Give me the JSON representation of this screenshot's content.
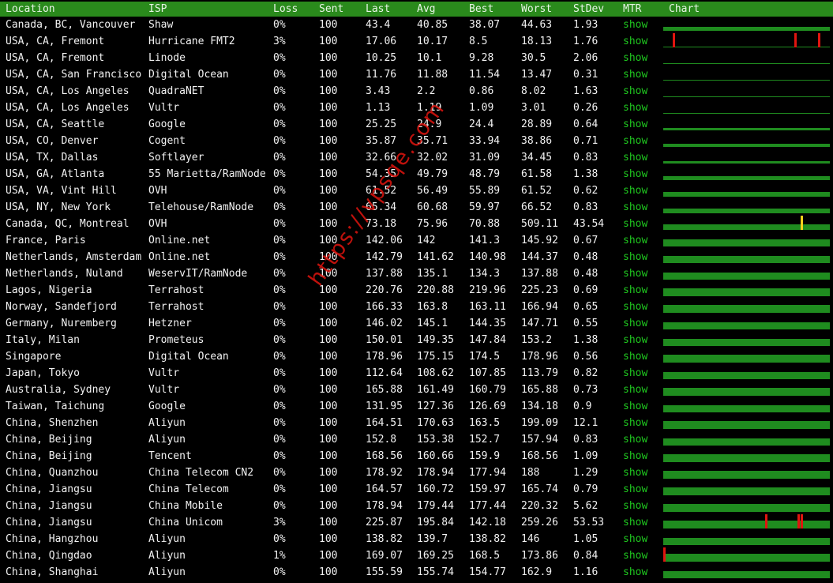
{
  "columns": [
    "Location",
    "ISP",
    "Loss",
    "Sent",
    "Last",
    "Avg",
    "Best",
    "Worst",
    "StDev",
    "MTR",
    "Chart"
  ],
  "colors": {
    "header_bg": "#2a8a1c",
    "link": "#1fc71f",
    "spark_green": "#1f8c1f",
    "loss_red": "#e0150f",
    "latency_yellow": "#f2d21c"
  },
  "watermark": "https://vpsqe.com",
  "rows": [
    {
      "location": "Canada, BC, Vancouver",
      "isp": "Shaw",
      "loss": "0%",
      "sent": "100",
      "last": "43.4",
      "avg": "40.85",
      "best": "38.07",
      "worst": "44.63",
      "stdev": "1.93",
      "mtr": "show",
      "spark_level": 0.5,
      "spikes": []
    },
    {
      "location": "USA, CA, Fremont",
      "isp": "Hurricane FMT2",
      "loss": "3%",
      "sent": "100",
      "last": "17.06",
      "avg": "10.17",
      "best": "8.5",
      "worst": "18.13",
      "stdev": "1.76",
      "mtr": "show",
      "spark_level": 0.1,
      "spikes": [
        {
          "pos": 0.06,
          "color": "red"
        },
        {
          "pos": 0.81,
          "color": "red"
        },
        {
          "pos": 0.96,
          "color": "red"
        }
      ]
    },
    {
      "location": "USA, CA, Fremont",
      "isp": "Linode",
      "loss": "0%",
      "sent": "100",
      "last": "10.25",
      "avg": "10.1",
      "best": "9.28",
      "worst": "30.5",
      "stdev": "2.06",
      "mtr": "show",
      "spark_level": 0.05,
      "spikes": []
    },
    {
      "location": "USA, CA, San Francisco",
      "isp": "Digital Ocean",
      "loss": "0%",
      "sent": "100",
      "last": "11.76",
      "avg": "11.88",
      "best": "11.54",
      "worst": "13.47",
      "stdev": "0.31",
      "mtr": "show",
      "spark_level": 0.05,
      "spikes": []
    },
    {
      "location": "USA, CA, Los Angeles",
      "isp": "QuadraNET",
      "loss": "0%",
      "sent": "100",
      "last": "3.43",
      "avg": "2.2",
      "best": "0.86",
      "worst": "8.02",
      "stdev": "1.63",
      "mtr": "show",
      "spark_level": 0.05,
      "spikes": []
    },
    {
      "location": "USA, CA, Los Angeles",
      "isp": "Vultr",
      "loss": "0%",
      "sent": "100",
      "last": "1.13",
      "avg": "1.19",
      "best": "1.09",
      "worst": "3.01",
      "stdev": "0.26",
      "mtr": "show",
      "spark_level": 0.05,
      "spikes": []
    },
    {
      "location": "USA, CA, Seattle",
      "isp": "Google",
      "loss": "0%",
      "sent": "100",
      "last": "25.25",
      "avg": "24.9",
      "best": "24.4",
      "worst": "28.89",
      "stdev": "0.64",
      "mtr": "show",
      "spark_level": 0.25,
      "spikes": []
    },
    {
      "location": "USA, CO, Denver",
      "isp": "Cogent",
      "loss": "0%",
      "sent": "100",
      "last": "35.87",
      "avg": "35.71",
      "best": "33.94",
      "worst": "38.86",
      "stdev": "0.71",
      "mtr": "show",
      "spark_level": 0.35,
      "spikes": []
    },
    {
      "location": "USA, TX, Dallas",
      "isp": "Softlayer",
      "loss": "0%",
      "sent": "100",
      "last": "32.66",
      "avg": "32.02",
      "best": "31.09",
      "worst": "34.45",
      "stdev": "0.83",
      "mtr": "show",
      "spark_level": 0.3,
      "spikes": []
    },
    {
      "location": "USA, GA, Atlanta",
      "isp": "55 Marietta/RamNode",
      "loss": "0%",
      "sent": "100",
      "last": "54.35",
      "avg": "49.79",
      "best": "48.79",
      "worst": "61.58",
      "stdev": "1.38",
      "mtr": "show",
      "spark_level": 0.5,
      "spikes": []
    },
    {
      "location": "USA, VA, Vint Hill",
      "isp": "OVH",
      "loss": "0%",
      "sent": "100",
      "last": "61.52",
      "avg": "56.49",
      "best": "55.89",
      "worst": "61.52",
      "stdev": "0.62",
      "mtr": "show",
      "spark_level": 0.55,
      "spikes": []
    },
    {
      "location": "USA, NY, New York",
      "isp": "Telehouse/RamNode",
      "loss": "0%",
      "sent": "100",
      "last": "65.34",
      "avg": "60.68",
      "best": "59.97",
      "worst": "66.52",
      "stdev": "0.83",
      "mtr": "show",
      "spark_level": 0.6,
      "spikes": []
    },
    {
      "location": "Canada, QC, Montreal",
      "isp": "OVH",
      "loss": "0%",
      "sent": "100",
      "last": "73.18",
      "avg": "75.96",
      "best": "70.88",
      "worst": "509.11",
      "stdev": "43.54",
      "mtr": "show",
      "spark_level": 0.65,
      "spikes": [
        {
          "pos": 0.85,
          "color": "yellow"
        }
      ]
    },
    {
      "location": "France, Paris",
      "isp": "Online.net",
      "loss": "0%",
      "sent": "100",
      "last": "142.06",
      "avg": "142",
      "best": "141.3",
      "worst": "145.92",
      "stdev": "0.67",
      "mtr": "show",
      "spark_level": 0.9,
      "spikes": []
    },
    {
      "location": "Netherlands, Amsterdam",
      "isp": "Online.net",
      "loss": "0%",
      "sent": "100",
      "last": "142.79",
      "avg": "141.62",
      "best": "140.98",
      "worst": "144.37",
      "stdev": "0.48",
      "mtr": "show",
      "spark_level": 0.9,
      "spikes": []
    },
    {
      "location": "Netherlands, Nuland",
      "isp": "WeservIT/RamNode",
      "loss": "0%",
      "sent": "100",
      "last": "137.88",
      "avg": "135.1",
      "best": "134.3",
      "worst": "137.88",
      "stdev": "0.48",
      "mtr": "show",
      "spark_level": 0.9,
      "spikes": []
    },
    {
      "location": "Lagos, Nigeria",
      "isp": "Terrahost",
      "loss": "0%",
      "sent": "100",
      "last": "220.76",
      "avg": "220.88",
      "best": "219.96",
      "worst": "225.23",
      "stdev": "0.69",
      "mtr": "show",
      "spark_level": 1.0,
      "spikes": []
    },
    {
      "location": "Norway, Sandefjord",
      "isp": "Terrahost",
      "loss": "0%",
      "sent": "100",
      "last": "166.33",
      "avg": "163.8",
      "best": "163.11",
      "worst": "166.94",
      "stdev": "0.65",
      "mtr": "show",
      "spark_level": 0.95,
      "spikes": []
    },
    {
      "location": "Germany, Nuremberg",
      "isp": "Hetzner",
      "loss": "0%",
      "sent": "100",
      "last": "146.02",
      "avg": "145.1",
      "best": "144.35",
      "worst": "147.71",
      "stdev": "0.55",
      "mtr": "show",
      "spark_level": 0.9,
      "spikes": []
    },
    {
      "location": "Italy, Milan",
      "isp": "Prometeus",
      "loss": "0%",
      "sent": "100",
      "last": "150.01",
      "avg": "149.35",
      "best": "147.84",
      "worst": "153.2",
      "stdev": "1.38",
      "mtr": "show",
      "spark_level": 0.9,
      "spikes": []
    },
    {
      "location": "Singapore",
      "isp": "Digital Ocean",
      "loss": "0%",
      "sent": "100",
      "last": "178.96",
      "avg": "175.15",
      "best": "174.5",
      "worst": "178.96",
      "stdev": "0.56",
      "mtr": "show",
      "spark_level": 0.95,
      "spikes": []
    },
    {
      "location": "Japan, Tokyo",
      "isp": "Vultr",
      "loss": "0%",
      "sent": "100",
      "last": "112.64",
      "avg": "108.62",
      "best": "107.85",
      "worst": "113.79",
      "stdev": "0.82",
      "mtr": "show",
      "spark_level": 0.85,
      "spikes": []
    },
    {
      "location": "Australia, Sydney",
      "isp": "Vultr",
      "loss": "0%",
      "sent": "100",
      "last": "165.88",
      "avg": "161.49",
      "best": "160.79",
      "worst": "165.88",
      "stdev": "0.73",
      "mtr": "show",
      "spark_level": 0.95,
      "spikes": []
    },
    {
      "location": "Taiwan, Taichung",
      "isp": "Google",
      "loss": "0%",
      "sent": "100",
      "last": "131.95",
      "avg": "127.36",
      "best": "126.69",
      "worst": "134.18",
      "stdev": "0.9",
      "mtr": "show",
      "spark_level": 0.85,
      "spikes": []
    },
    {
      "location": "China, Shenzhen",
      "isp": "Aliyun",
      "loss": "0%",
      "sent": "100",
      "last": "164.51",
      "avg": "170.63",
      "best": "163.5",
      "worst": "199.09",
      "stdev": "12.1",
      "mtr": "show",
      "spark_level": 0.95,
      "spikes": []
    },
    {
      "location": "China, Beijing",
      "isp": "Aliyun",
      "loss": "0%",
      "sent": "100",
      "last": "152.8",
      "avg": "153.38",
      "best": "152.7",
      "worst": "157.94",
      "stdev": "0.83",
      "mtr": "show",
      "spark_level": 0.9,
      "spikes": []
    },
    {
      "location": "China, Beijing",
      "isp": "Tencent",
      "loss": "0%",
      "sent": "100",
      "last": "168.56",
      "avg": "160.66",
      "best": "159.9",
      "worst": "168.56",
      "stdev": "1.09",
      "mtr": "show",
      "spark_level": 0.95,
      "spikes": []
    },
    {
      "location": "China, Quanzhou",
      "isp": "China Telecom CN2",
      "loss": "0%",
      "sent": "100",
      "last": "178.92",
      "avg": "178.94",
      "best": "177.94",
      "worst": "188",
      "stdev": "1.29",
      "mtr": "show",
      "spark_level": 0.95,
      "spikes": []
    },
    {
      "location": "China, Jiangsu",
      "isp": "China Telecom",
      "loss": "0%",
      "sent": "100",
      "last": "164.57",
      "avg": "160.72",
      "best": "159.97",
      "worst": "165.74",
      "stdev": "0.79",
      "mtr": "show",
      "spark_level": 0.95,
      "spikes": []
    },
    {
      "location": "China, Jiangsu",
      "isp": "China Mobile",
      "loss": "0%",
      "sent": "100",
      "last": "178.94",
      "avg": "179.44",
      "best": "177.44",
      "worst": "220.32",
      "stdev": "5.62",
      "mtr": "show",
      "spark_level": 0.95,
      "spikes": []
    },
    {
      "location": "China, Jiangsu",
      "isp": "China Unicom",
      "loss": "3%",
      "sent": "100",
      "last": "225.87",
      "avg": "195.84",
      "best": "142.18",
      "worst": "259.26",
      "stdev": "53.53",
      "mtr": "show",
      "spark_level": 1.0,
      "spikes": [
        {
          "pos": 0.63,
          "color": "red"
        },
        {
          "pos": 0.83,
          "color": "red"
        },
        {
          "pos": 0.85,
          "color": "red"
        }
      ]
    },
    {
      "location": "China, Hangzhou",
      "isp": "Aliyun",
      "loss": "0%",
      "sent": "100",
      "last": "138.82",
      "avg": "139.7",
      "best": "138.82",
      "worst": "146",
      "stdev": "1.05",
      "mtr": "show",
      "spark_level": 0.9,
      "spikes": []
    },
    {
      "location": "China, Qingdao",
      "isp": "Aliyun",
      "loss": "1%",
      "sent": "100",
      "last": "169.07",
      "avg": "169.25",
      "best": "168.5",
      "worst": "173.86",
      "stdev": "0.84",
      "mtr": "show",
      "spark_level": 0.95,
      "spikes": [
        {
          "pos": 0.0,
          "color": "red"
        }
      ]
    },
    {
      "location": "China, Shanghai",
      "isp": "Aliyun",
      "loss": "0%",
      "sent": "100",
      "last": "155.59",
      "avg": "155.74",
      "best": "154.77",
      "worst": "162.9",
      "stdev": "1.16",
      "mtr": "show",
      "spark_level": 0.9,
      "spikes": []
    }
  ]
}
